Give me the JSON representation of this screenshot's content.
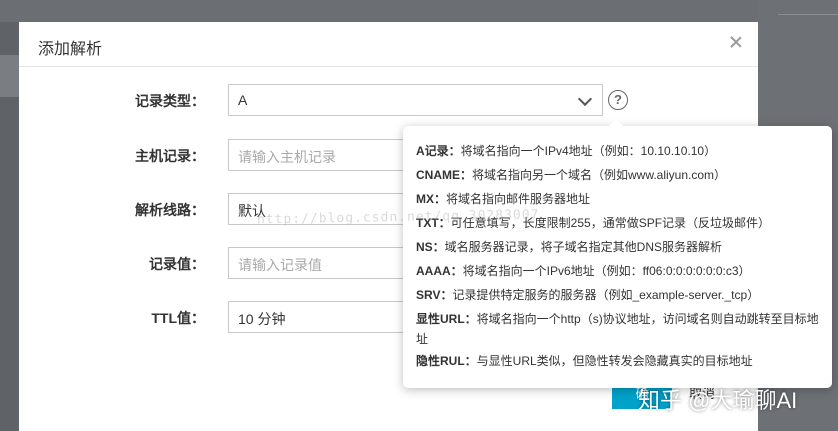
{
  "dialog": {
    "title": "添加解析",
    "close_label": "×"
  },
  "form": {
    "record_type": {
      "label": "记录类型：",
      "value": "A"
    },
    "host_record": {
      "label": "主机记录：",
      "placeholder": "请输入主机记录"
    },
    "resolution_line": {
      "label": "解析线路：",
      "value": "默认"
    },
    "record_value": {
      "label": "记录值：",
      "placeholder": "请输入记录值"
    },
    "ttl": {
      "label": "TTL值：",
      "value": "10 分钟"
    },
    "help_icon_glyph": "?"
  },
  "buttons": {
    "confirm": "确",
    "cancel": "取消"
  },
  "help_popover": {
    "items": [
      {
        "term": "A记录：",
        "desc": "将域名指向一个IPv4地址（例如：10.10.10.10）"
      },
      {
        "term": "CNAME：",
        "desc": "将域名指向另一个域名（例如www.aliyun.com）"
      },
      {
        "term": "MX：",
        "desc": "将域名指向邮件服务器地址"
      },
      {
        "term": "TXT：",
        "desc": "可任意填写，长度限制255，通常做SPF记录（反垃圾邮件）"
      },
      {
        "term": "NS：",
        "desc": "域名服务器记录，将子域名指定其他DNS服务器解析"
      },
      {
        "term": "AAAA：",
        "desc": "将域名指向一个IPv6地址（例如：ff06:0:0:0:0:0:0:c3）"
      },
      {
        "term": "SRV：",
        "desc": "记录提供特定服务的服务器（例如_example-server._tcp）"
      },
      {
        "term": "显性URL：",
        "desc": "将域名指向一个http（s)协议地址，访问域名则自动跳转至目标地址"
      },
      {
        "term": "隐性RUL：",
        "desc": "与显性URL类似，但隐性转发会隐藏真实的目标地址"
      }
    ]
  },
  "overlays": {
    "watermark": "http://blog.csdn.net/qq_30283007",
    "zhihu": "知乎 @大瑜聊AI"
  },
  "colors": {
    "primary_button": "#00a2ca",
    "backdrop": "#5f6367"
  }
}
